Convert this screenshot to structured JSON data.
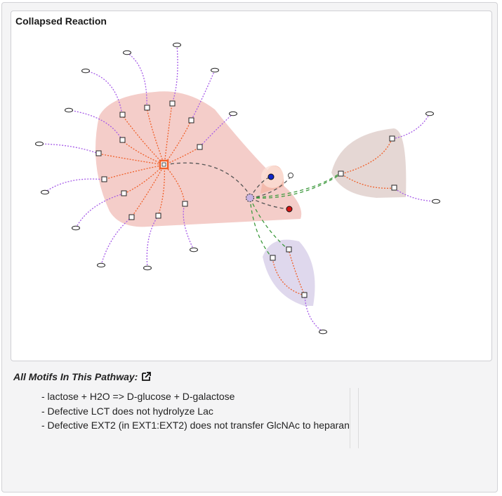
{
  "graph": {
    "title": "Collapsed Reaction"
  },
  "motifs": {
    "header": "All Motifs In This Pathway:",
    "icon": "external-link-icon",
    "items": [
      "- lactose + H2O => D-glucose + D-galactose",
      "- Defective LCT does not hydrolyze Lac",
      "- Defective EXT2 (in EXT1:EXT2) does not transfer GlcNAc to heparan"
    ]
  },
  "colors": {
    "cluster_red": "#f2c4c0",
    "cluster_brown": "#e4d5d2",
    "cluster_purple": "#ddd6ec",
    "edge_orange": "#f0602a",
    "edge_purple": "#a65be8",
    "edge_green": "#3f9a3f",
    "edge_dark": "#555555",
    "node_blue": "#1027c8",
    "node_red": "#d41414"
  }
}
